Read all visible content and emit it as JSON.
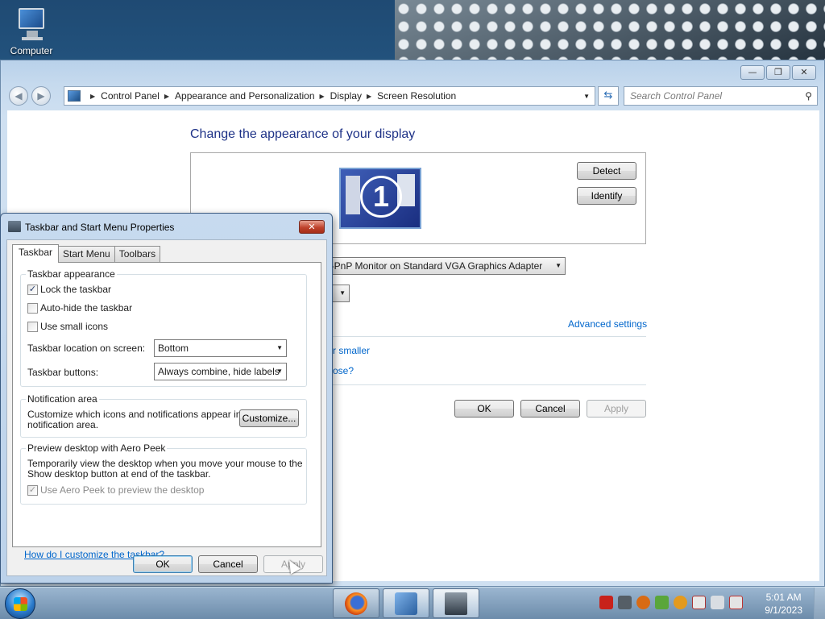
{
  "desktop": {
    "icon_label": "Computer"
  },
  "control_panel": {
    "breadcrumb": [
      "Control Panel",
      "Appearance and Personalization",
      "Display",
      "Screen Resolution"
    ],
    "search_placeholder": "Search Control Panel",
    "heading": "Change the appearance of your display",
    "monitor_number": "1",
    "detect_label": "Detect",
    "identify_label": "Identify",
    "display_combo_value": "n-PnP Monitor on Standard VGA Graphics Adapter",
    "advanced_settings_link": "Advanced settings",
    "partial_link_1": "r smaller",
    "partial_link_2": "ose?",
    "ok_label": "OK",
    "cancel_label": "Cancel",
    "apply_label": "Apply"
  },
  "dialog": {
    "title": "Taskbar and Start Menu Properties",
    "close_glyph": "✕",
    "tabs": [
      "Taskbar",
      "Start Menu",
      "Toolbars"
    ],
    "appearance_group": {
      "label": "Taskbar appearance",
      "lock_label": "Lock the taskbar",
      "lock_checked": true,
      "autohide_label": "Auto-hide the taskbar",
      "autohide_checked": false,
      "small_icons_label": "Use small icons",
      "small_icons_checked": false,
      "location_label": "Taskbar location on screen:",
      "location_value": "Bottom",
      "buttons_label": "Taskbar buttons:",
      "buttons_value": "Always combine, hide labels"
    },
    "notification_group": {
      "label": "Notification area",
      "text_line1": "Customize which icons and notifications appear in the",
      "text_line2": "notification area.",
      "customize_label": "Customize..."
    },
    "aero_group": {
      "label": "Preview desktop with Aero Peek",
      "text_line1": "Temporarily view the desktop when you move your mouse to the",
      "text_line2": "Show desktop button at end of the taskbar.",
      "aero_label": "Use Aero Peek to preview the desktop",
      "aero_checked": true
    },
    "help_link": "How do I customize the taskbar?",
    "ok_label": "OK",
    "cancel_label": "Cancel",
    "apply_label": "Apply"
  },
  "taskbar": {
    "time": "5:01 AM",
    "date": "9/1/2023",
    "apps": [
      "firefox-icon",
      "control-panel-icon",
      "taskbar-properties-icon"
    ],
    "tray_icons": [
      "acrobat-icon",
      "network-tools-icon",
      "search-tool-icon",
      "utorrent-icon",
      "update-icon",
      "flag-icon",
      "network-icon",
      "volume-muted-icon"
    ]
  }
}
